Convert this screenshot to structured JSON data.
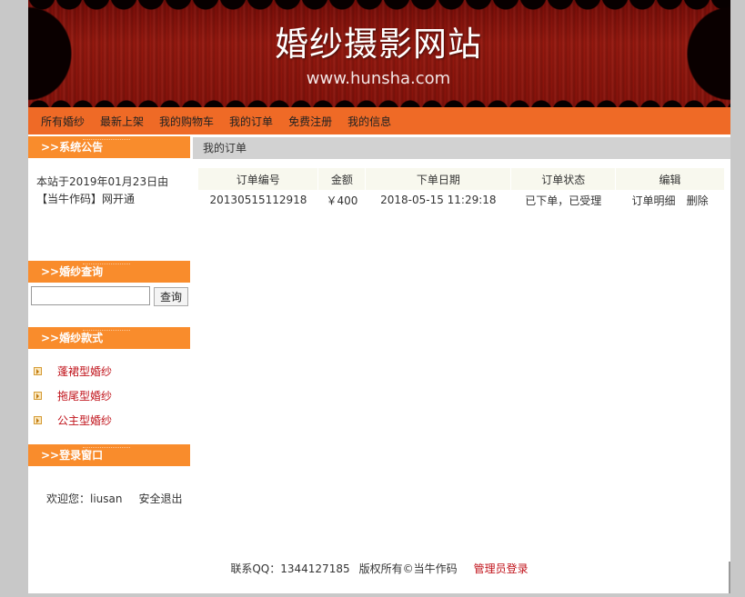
{
  "banner": {
    "title": "婚纱摄影网站",
    "url": "www.hunsha.com"
  },
  "nav": {
    "items": [
      "所有婚纱",
      "最新上架",
      "我的购物车",
      "我的订单",
      "免费注册",
      "我的信息"
    ]
  },
  "sidebar": {
    "notice_title": ">>系统公告",
    "notice_text": "本站于2019年01月23日由【当牛作码】网开通",
    "search_title": ">>婚纱查询",
    "search_placeholder": "",
    "search_button": "查询",
    "styles_title": ">>婚纱款式",
    "styles": [
      "蓬裙型婚纱",
      "拖尾型婚纱",
      "公主型婚纱"
    ],
    "login_title": ">>登录窗口",
    "welcome": "欢迎您：liusan",
    "logout": "安全退出"
  },
  "main": {
    "title": "我的订单",
    "table": {
      "headers": [
        "订单编号",
        "金额",
        "下单日期",
        "订单状态",
        "编辑"
      ],
      "rows": [
        {
          "order_no": "20130515112918",
          "amount": "￥400",
          "date": "2018-05-15 11:29:18",
          "status": "已下单，已受理",
          "detail": "订单明细",
          "delete": "删除"
        }
      ]
    }
  },
  "footer": {
    "contact": "联系QQ：1344127185",
    "copyright": "版权所有©当牛作码",
    "admin": "管理员登录"
  },
  "colors": {
    "nav": "#ef6a26",
    "side_header": "#f98c2c",
    "link_red": "#c0121a",
    "main_header": "#d2d2d2"
  }
}
